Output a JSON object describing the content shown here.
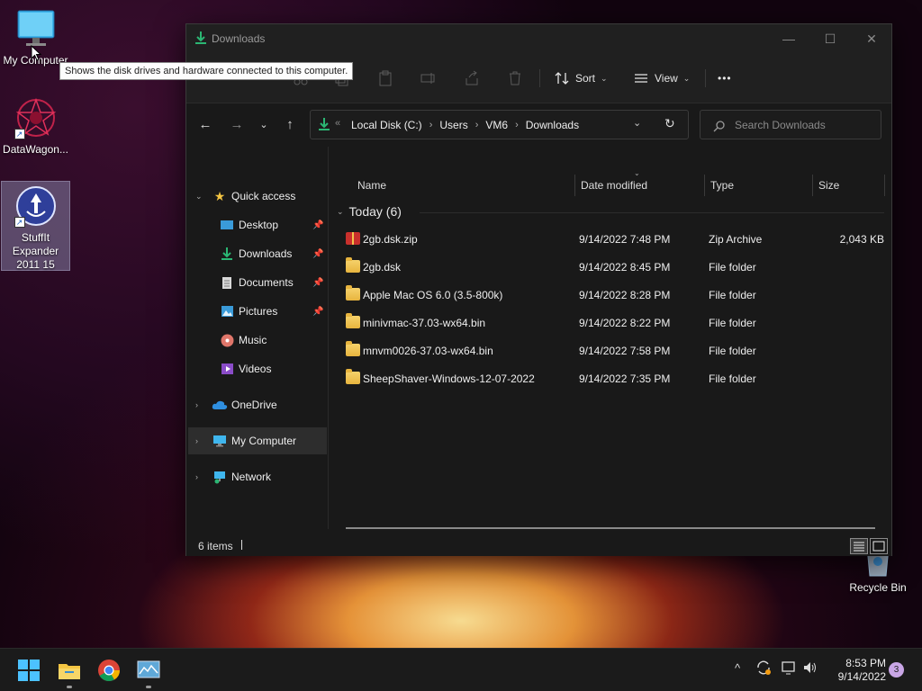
{
  "desktop": {
    "icons": [
      {
        "label": "My Computer",
        "icon": "monitor-icon"
      },
      {
        "label": "DataWagon...",
        "icon": "datawagon-icon"
      },
      {
        "label": "StuffIt Expander 2011 15",
        "icon": "stuffit-icon"
      },
      {
        "label": "Recycle Bin",
        "icon": "recycle-bin-icon"
      }
    ],
    "tooltip": "Shows the disk drives and hardware connected to this computer."
  },
  "window": {
    "title": "Downloads",
    "controls": {
      "minimize": "—",
      "maximize": "☐",
      "close": "✕"
    },
    "toolbar": {
      "sort_label": "Sort",
      "view_label": "View",
      "more_label": "•••"
    },
    "address": {
      "overflow": "«",
      "crumbs": [
        "Local Disk (C:)",
        "Users",
        "VM6",
        "Downloads"
      ]
    },
    "search": {
      "placeholder": "Search Downloads"
    },
    "nav": {
      "quick_access": "Quick access",
      "items": [
        {
          "label": "Desktop",
          "icon": "desktop-icon",
          "pinned": true
        },
        {
          "label": "Downloads",
          "icon": "download-arrow-icon",
          "pinned": true
        },
        {
          "label": "Documents",
          "icon": "documents-icon",
          "pinned": true
        },
        {
          "label": "Pictures",
          "icon": "pictures-icon",
          "pinned": true
        },
        {
          "label": "Music",
          "icon": "music-icon",
          "pinned": false
        },
        {
          "label": "Videos",
          "icon": "videos-icon",
          "pinned": false
        }
      ],
      "onedrive": "OneDrive",
      "my_computer": "My Computer",
      "network": "Network"
    },
    "columns": {
      "name": "Name",
      "date": "Date modified",
      "type": "Type",
      "size": "Size"
    },
    "group": "Today (6)",
    "files": [
      {
        "name": "2gb.dsk.zip",
        "date": "9/14/2022 7:48 PM",
        "type": "Zip Archive",
        "size": "2,043 KB",
        "kind": "zip"
      },
      {
        "name": "2gb.dsk",
        "date": "9/14/2022 8:45 PM",
        "type": "File folder",
        "size": "",
        "kind": "folder"
      },
      {
        "name": "Apple Mac OS 6.0 (3.5-800k)",
        "date": "9/14/2022 8:28 PM",
        "type": "File folder",
        "size": "",
        "kind": "folder"
      },
      {
        "name": "minivmac-37.03-wx64.bin",
        "date": "9/14/2022 8:22 PM",
        "type": "File folder",
        "size": "",
        "kind": "folder"
      },
      {
        "name": "mnvm0026-37.03-wx64.bin",
        "date": "9/14/2022 7:58 PM",
        "type": "File folder",
        "size": "",
        "kind": "folder"
      },
      {
        "name": "SheepShaver-Windows-12-07-2022",
        "date": "9/14/2022 7:35 PM",
        "type": "File folder",
        "size": "",
        "kind": "folder"
      }
    ],
    "status": "6 items"
  },
  "taskbar": {
    "apps": [
      "start-icon",
      "file-explorer-icon",
      "chrome-icon",
      "monitor-app-icon"
    ],
    "clock": {
      "time": "8:53 PM",
      "date": "9/14/2022"
    },
    "notification_count": "3"
  }
}
